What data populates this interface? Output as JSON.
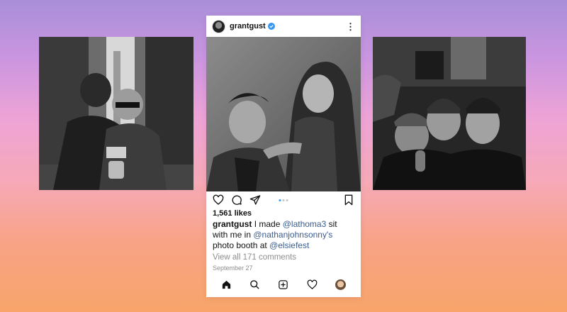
{
  "post": {
    "username": "grantgust",
    "likes": "1,561 likes",
    "caption": {
      "username": "grantgust",
      "text1": "I made",
      "mention1": "@lathoma3",
      "text2": "sit with me in",
      "mention2": "@nathanjohnsonny's",
      "text3": "photo booth at",
      "mention3": "@elsiefest"
    },
    "comments_link": "View all 171 comments",
    "date": "September 27",
    "carousel": {
      "total": 3,
      "active": 1
    }
  },
  "icons": {
    "verified": "verified-badge-icon",
    "more": "more-options-icon",
    "like": "heart-icon",
    "comment": "comment-icon",
    "share": "send-icon",
    "save": "bookmark-icon",
    "home": "home-icon",
    "search": "search-icon",
    "new_post": "new-post-icon",
    "activity": "heart-icon",
    "profile": "profile-avatar"
  },
  "colors": {
    "verified": "#3897f0",
    "mention": "#3b5c8f",
    "muted": "#8e8e8e",
    "carousel_active": "#3897f0"
  }
}
